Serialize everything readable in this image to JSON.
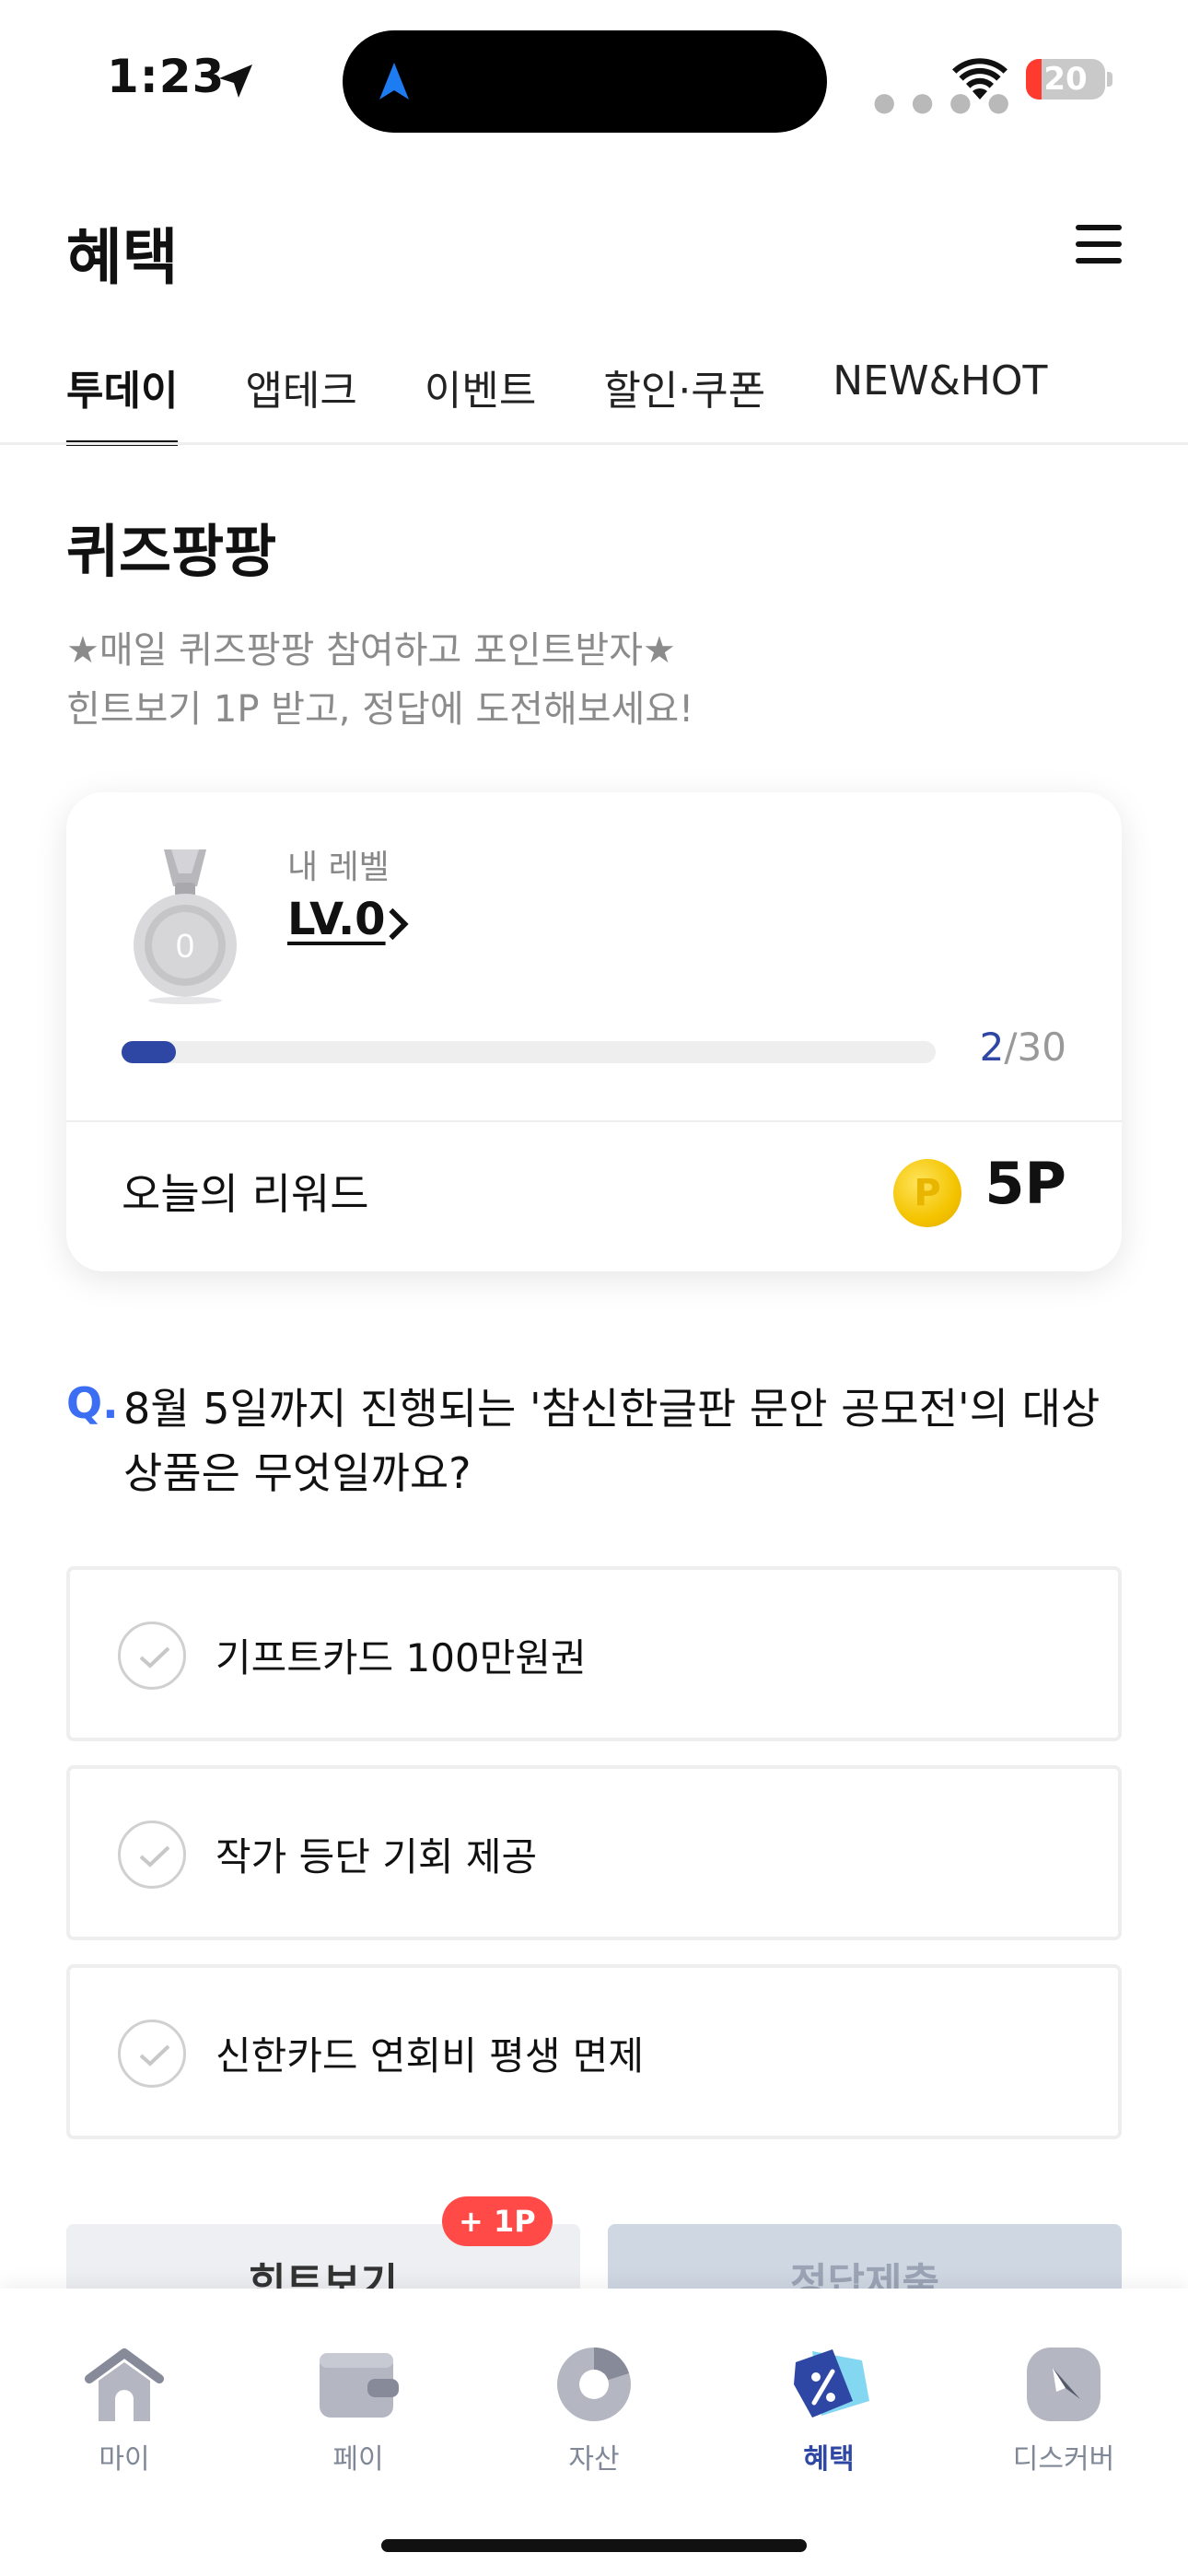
{
  "status_bar": {
    "time": "1:23",
    "battery": "20",
    "battery_level": 0.2
  },
  "header": {
    "title": "혜택"
  },
  "tabs": [
    {
      "label": "투데이",
      "active": true
    },
    {
      "label": "앱테크",
      "active": false
    },
    {
      "label": "이벤트",
      "active": false
    },
    {
      "label": "할인·쿠폰",
      "active": false
    },
    {
      "label": "NEW&HOT",
      "active": false
    }
  ],
  "quiz": {
    "title": "퀴즈팡팡",
    "desc_line1": "★매일 퀴즈팡팡 참여하고 포인트받자★",
    "desc_line2": "힌트보기 1P 받고, 정답에 도전해보세요!"
  },
  "level_card": {
    "medal_number": "0",
    "level_label": "내 레벨",
    "level_value": "LV.0",
    "progress_current": "2",
    "progress_total": "/30",
    "progress_fraction": 0.0667,
    "reward_label": "오늘의 리워드",
    "coin_letter": "P",
    "reward_value": "5P"
  },
  "question": {
    "mark": "Q.",
    "text": "8월 5일까지 진행되는 '참신한글판 문안 공모전'의 대상 상품은 무엇일까요?"
  },
  "options": [
    {
      "label": "기프트카드 100만원권"
    },
    {
      "label": "작가 등단 기회 제공"
    },
    {
      "label": "신한카드 연회비 평생 면제"
    }
  ],
  "actions": {
    "hint_label": "힌트보기",
    "hint_badge": "+ 1P",
    "submit_label": "정답제출"
  },
  "tabbar": [
    {
      "label": "마이",
      "icon": "house-icon",
      "active": false
    },
    {
      "label": "페이",
      "icon": "wallet-icon",
      "active": false
    },
    {
      "label": "자산",
      "icon": "pie-chart-icon",
      "active": false
    },
    {
      "label": "혜택",
      "icon": "benefit-tag-icon",
      "active": true
    },
    {
      "label": "디스커버",
      "icon": "compass-icon",
      "active": false
    }
  ],
  "colors": {
    "accent": "#2e47a4",
    "question_mark": "#3b6ef2",
    "badge": "#ff4a48",
    "coin": "#f4c400"
  }
}
